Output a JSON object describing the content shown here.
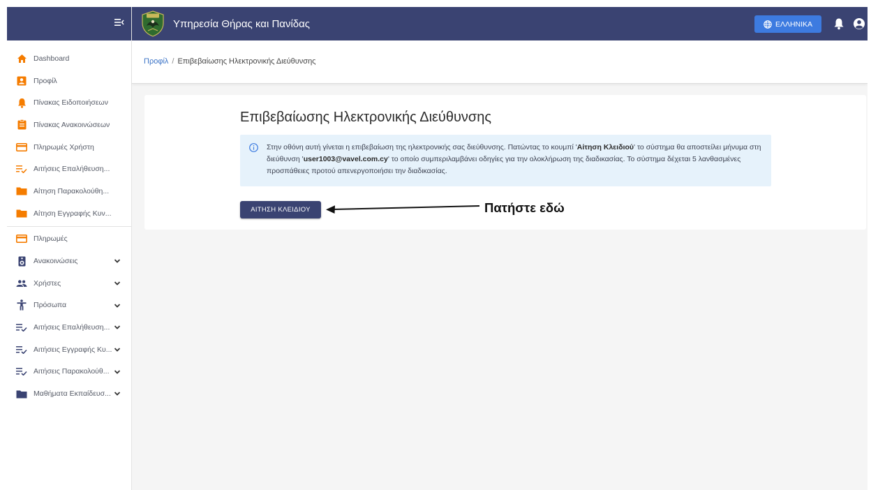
{
  "app": {
    "title": "Υπηρεσία Θήρας και Πανίδας",
    "language_label": "ΕΛΛΗΝΙΚΑ",
    "brand_color": "#3a4372",
    "accent_color": "#3d7be0"
  },
  "sidebar": {
    "toggle_icon": "menu-collapse-icon",
    "items": [
      {
        "label": "Dashboard",
        "icon": "home-icon",
        "color": "#f57c00"
      },
      {
        "label": "Προφίλ",
        "icon": "profile-card-icon",
        "color": "#f57c00"
      },
      {
        "label": "Πίνακας Ειδοποιήσεων",
        "icon": "bell-icon",
        "color": "#f57c00"
      },
      {
        "label": "Πίνακας Ανακοινώσεων",
        "icon": "clipboard-icon",
        "color": "#f57c00"
      },
      {
        "label": "Πληρωμές Χρήστη",
        "icon": "credit-card-icon",
        "color": "#f57c00"
      },
      {
        "label": "Αιτήσεις Επαλήθευση...",
        "icon": "list-check-icon",
        "color": "#f57c00"
      },
      {
        "label": "Αίτηση Παρακολούθη...",
        "icon": "folder-icon",
        "color": "#f57c00"
      },
      {
        "label": "Αίτηση Εγγραφής Κυν...",
        "icon": "folder-icon",
        "color": "#f57c00"
      },
      {
        "label": "Πληρωμές",
        "icon": "credit-card-icon",
        "color": "#f57c00"
      },
      {
        "label": "Ανακοινώσεις",
        "icon": "speaker-icon",
        "color": "#3a4372"
      },
      {
        "label": "Χρήστες",
        "icon": "users-icon",
        "color": "#3a4372"
      },
      {
        "label": "Πρόσωπα",
        "icon": "person-icon",
        "color": "#3a4372"
      },
      {
        "label": "Αιτήσεις Επαλήθευση...",
        "icon": "list-check-icon",
        "color": "#3a4372"
      },
      {
        "label": "Αιτήσεις Εγγραφής Κυ...",
        "icon": "list-check-icon",
        "color": "#3a4372"
      },
      {
        "label": "Αιτήσεις Παρακολούθ...",
        "icon": "list-check-icon",
        "color": "#3a4372"
      },
      {
        "label": "Μαθήματα Εκπαίδευσ...",
        "icon": "folder-icon",
        "color": "#3a4372"
      }
    ]
  },
  "breadcrumb": {
    "parent": "Προφίλ",
    "separator": "/",
    "current": "Επιβεβαίωσης Ηλεκτρονικής Διεύθυνσης"
  },
  "main": {
    "title": "Επιβεβαίωσης Ηλεκτρονικής Διεύθυνσης",
    "info": {
      "part1": "Στην οθόνη αυτή γίνεται η επιβεβαίωση της ηλεκτρονικής σας διεύθυνσης. Πατώντας το κουμπί '",
      "button_name": "Αίτηση Κλειδιού",
      "part2": "' το σύστημα θα αποστείλει μήνυμα στη διεύθυνση '",
      "email": "user1003@vavel.com.cy",
      "part3": "' το οποίο συμπεριλαμβάνει οδηγίες για την ολοκλήρωση της διαδικασίας. Το σύστημα δέχεται 5 λανθασμένες προσπάθειες προτού απενεργοποιήσει την διαδικασίας."
    },
    "request_key_button": "ΑΙΤΗΣΗ ΚΛΕΙΔΙΟΥ",
    "annotation": "Πατήστε εδώ"
  }
}
